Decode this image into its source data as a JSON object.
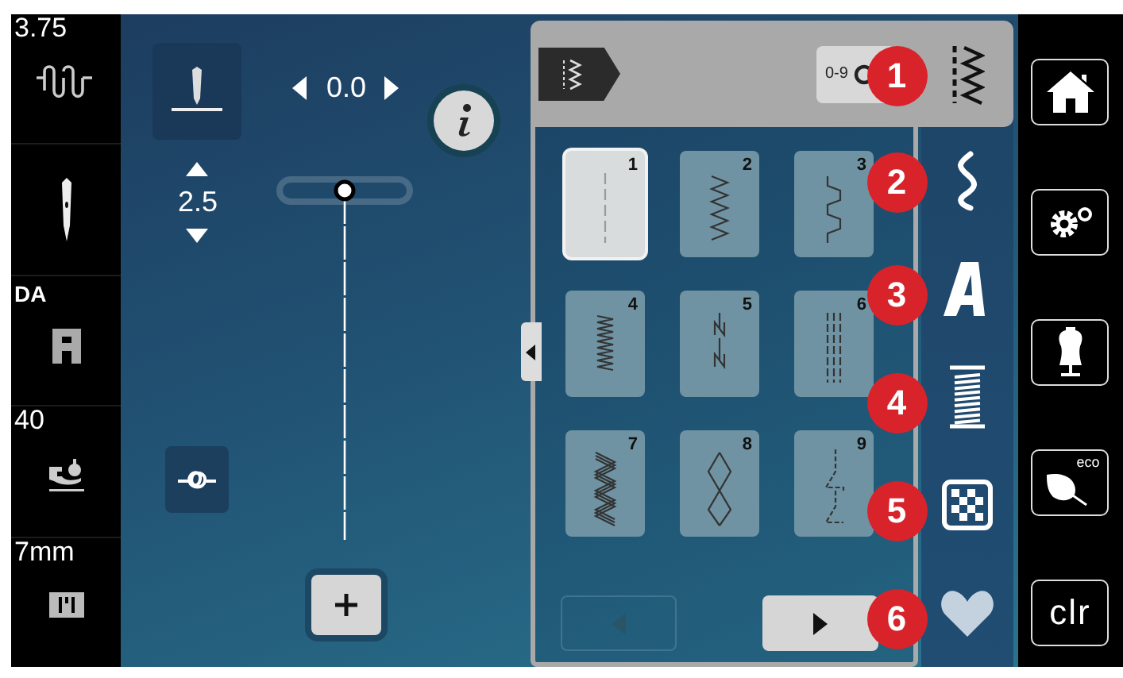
{
  "status": [
    {
      "kind": "tension",
      "value": "3.75"
    },
    {
      "kind": "needle"
    },
    {
      "kind": "foot",
      "value": "DA"
    },
    {
      "kind": "pressure",
      "value": "40"
    },
    {
      "kind": "plate",
      "value": "7mm"
    }
  ],
  "needle_position": {
    "value": "0.0"
  },
  "stitch_width": {
    "value": "2.5"
  },
  "panel": {
    "counter": "0-9",
    "stitches": [
      {
        "number": "1",
        "kind": "straight",
        "selected": true
      },
      {
        "number": "2",
        "kind": "zigzag",
        "selected": false
      },
      {
        "number": "3",
        "kind": "overlock",
        "selected": false
      },
      {
        "number": "4",
        "kind": "running",
        "selected": false
      },
      {
        "number": "5",
        "kind": "securing",
        "selected": false
      },
      {
        "number": "6",
        "kind": "triple",
        "selected": false
      },
      {
        "number": "7",
        "kind": "triplezigzag",
        "selected": false
      },
      {
        "number": "8",
        "kind": "honeycomb",
        "selected": false
      },
      {
        "number": "9",
        "kind": "blind",
        "selected": false
      }
    ],
    "pager": [
      {
        "kind": "prev",
        "disabled": true
      },
      {
        "kind": "next",
        "disabled": false
      }
    ]
  },
  "categories": [
    {
      "kind": "practical",
      "selected": true
    },
    {
      "kind": "decorative",
      "selected": false
    },
    {
      "kind": "alphabet",
      "selected": false
    },
    {
      "kind": "buttonhole",
      "selected": false
    },
    {
      "kind": "quilt",
      "selected": false
    },
    {
      "kind": "favorites",
      "selected": false
    }
  ],
  "callouts": [
    "1",
    "2",
    "3",
    "4",
    "5",
    "6"
  ],
  "nav": [
    {
      "kind": "home"
    },
    {
      "kind": "settings"
    },
    {
      "kind": "dress"
    },
    {
      "kind": "eco",
      "label": "eco"
    },
    {
      "kind": "clear",
      "label": "clr"
    }
  ]
}
